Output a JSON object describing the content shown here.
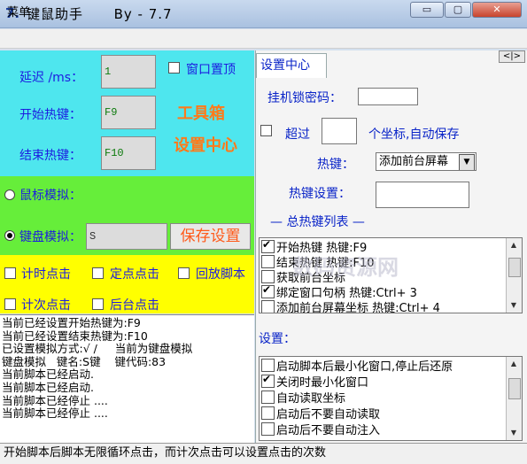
{
  "window": {
    "icon": "7.",
    "title": "键鼠助手      By - 7.7",
    "buttons": {
      "minimize": "▭",
      "maximize": "▢",
      "close": "✕"
    }
  },
  "menu": {
    "label": "菜单"
  },
  "cyan_panel": {
    "delay_label": "延迟 /ms：",
    "delay_value": "1",
    "always_on_top_label": "窗口置顶",
    "always_on_top_checked": false,
    "start_hotkey_label": "开始热键：",
    "start_hotkey_value": "F9",
    "end_hotkey_label": "结束热键：",
    "end_hotkey_value": "F10",
    "toolbox_label": "工具箱",
    "settings_center_label": "设置中心"
  },
  "green_panel": {
    "mouse_sim_label": "鼠标模拟：",
    "mouse_sim_selected": false,
    "keyboard_sim_label": "键盘模拟：",
    "keyboard_sim_selected": true,
    "keyboard_sim_value": "S",
    "save_button": "保存设置"
  },
  "yellow_panel": {
    "timed_click": "计时点击",
    "fixed_point_click": "定点点击",
    "replay_script": "回放脚本",
    "count_click": "计次点击",
    "background_click": "后台点击"
  },
  "log_lines": [
    "当前已经设置开始热键为:F9",
    "当前已经设置结束热键为:F10",
    "已设置模拟方式:√ /     当前为键盘模拟",
    "键盘模拟   键名:S键    键代码:83",
    "当前脚本已经启动.",
    "当前脚本已经启动.",
    "当前脚本已经停止 ....",
    "当前脚本已经停止 ...."
  ],
  "right_panel": {
    "tab_label": "设置中心",
    "tab_arrows": "<|>",
    "lock_password_label": "挂机锁密码：",
    "lock_password_value": "",
    "exceed_label": "超过",
    "exceed_value": "",
    "exceed_suffix": "个坐标,自动保存",
    "hotkey_label": "热键：",
    "hotkey_select_value": "添加前台屏幕",
    "hotkey_setting_label": "热键设置：",
    "hotkey_setting_value": "",
    "hotkey_list_title": "— 总热键列表 —",
    "hotkey_list": [
      {
        "text": "开始热键       热键:F9",
        "checked": true
      },
      {
        "text": "结束热键       热键:F10",
        "checked": false
      },
      {
        "text": "获取前台坐标",
        "checked": false
      },
      {
        "text": "绑定窗口句柄       热键:Ctrl+ 3",
        "checked": true
      },
      {
        "text": "添加前台屏幕坐标   热键:Ctrl+ 4",
        "checked": false
      }
    ],
    "settings_label": "设置：",
    "settings_list": [
      {
        "text": "启动脚本后最小化窗口,停止后还原",
        "checked": false
      },
      {
        "text": "关闭时最小化窗口",
        "checked": true
      },
      {
        "text": "自动读取坐标",
        "checked": false
      },
      {
        "text": "启动后不要自动读取",
        "checked": false
      },
      {
        "text": "启动后不要自动注入",
        "checked": false
      }
    ]
  },
  "status_bar": "开始脚本后脚本无限循环点击，而计次点击可以设置点击的次数",
  "watermark": "数码资源网"
}
